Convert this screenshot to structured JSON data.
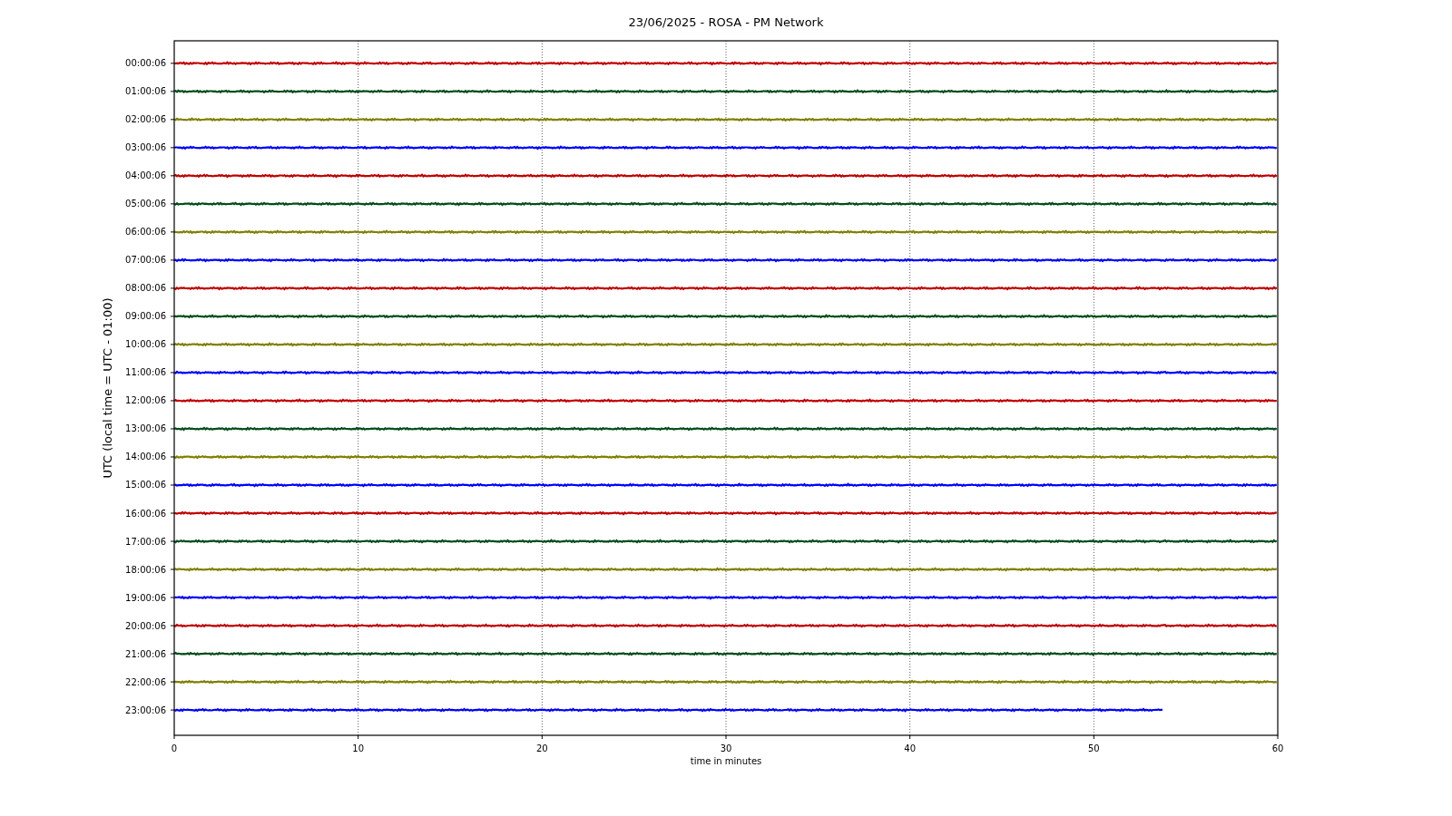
{
  "chart_data": {
    "type": "line",
    "title": "23/06/2025 - ROSA - PM Network",
    "xlabel": "time in minutes",
    "ylabel": "UTC (local time = UTC - 01:00)",
    "x": [
      0,
      53.8,
      60
    ],
    "xlim": [
      0,
      60
    ],
    "grid": "x",
    "ylim": [
      86046,
      -2874
    ],
    "xticks": [
      0,
      10,
      20,
      30,
      40,
      50,
      60
    ],
    "yticks": [
      {
        "value": 6,
        "label": "00:00:06"
      },
      {
        "value": 3606,
        "label": "01:00:06"
      },
      {
        "value": 7206,
        "label": "02:00:06"
      },
      {
        "value": 10806,
        "label": "03:00:06"
      },
      {
        "value": 14406,
        "label": "04:00:06"
      },
      {
        "value": 18006,
        "label": "05:00:06"
      },
      {
        "value": 21606,
        "label": "06:00:06"
      },
      {
        "value": 25206,
        "label": "07:00:06"
      },
      {
        "value": 28806,
        "label": "08:00:06"
      },
      {
        "value": 32406,
        "label": "09:00:06"
      },
      {
        "value": 36006,
        "label": "10:00:06"
      },
      {
        "value": 39606,
        "label": "11:00:06"
      },
      {
        "value": 43206,
        "label": "12:00:06"
      },
      {
        "value": 46806,
        "label": "13:00:06"
      },
      {
        "value": 50406,
        "label": "14:00:06"
      },
      {
        "value": 54006,
        "label": "15:00:06"
      },
      {
        "value": 57606,
        "label": "16:00:06"
      },
      {
        "value": 61206,
        "label": "17:00:06"
      },
      {
        "value": 64806,
        "label": "18:00:06"
      },
      {
        "value": 68406,
        "label": "19:00:06"
      },
      {
        "value": 72006,
        "label": "20:00:06"
      },
      {
        "value": 75606,
        "label": "21:00:06"
      },
      {
        "value": 79206,
        "label": "22:00:06"
      },
      {
        "value": 82806,
        "label": "23:00:06"
      }
    ],
    "series": [
      {
        "color": "#c00000",
        "values": [
          6,
          6,
          6
        ]
      },
      {
        "color": "#004d1a",
        "values": [
          3606,
          3606,
          3606
        ]
      },
      {
        "color": "#808000",
        "values": [
          7206,
          7206,
          7206
        ]
      },
      {
        "color": "#0000ff",
        "values": [
          10806,
          10806,
          10806
        ]
      },
      {
        "color": "#c00000",
        "values": [
          14406,
          14406,
          14406
        ]
      },
      {
        "color": "#004d1a",
        "values": [
          18006,
          18006,
          18006
        ]
      },
      {
        "color": "#808000",
        "values": [
          21606,
          21606,
          21606
        ]
      },
      {
        "color": "#0000ff",
        "values": [
          25206,
          25206,
          25206
        ]
      },
      {
        "color": "#c00000",
        "values": [
          28806,
          28806,
          28806
        ]
      },
      {
        "color": "#004d1a",
        "values": [
          32406,
          32406,
          32406
        ]
      },
      {
        "color": "#808000",
        "values": [
          36006,
          36006,
          36006
        ]
      },
      {
        "color": "#0000ff",
        "values": [
          39606,
          39606,
          39606
        ]
      },
      {
        "color": "#c00000",
        "values": [
          43206,
          43206,
          43206
        ]
      },
      {
        "color": "#004d1a",
        "values": [
          46806,
          46806,
          46806
        ]
      },
      {
        "color": "#808000",
        "values": [
          50406,
          50406,
          50406
        ]
      },
      {
        "color": "#0000ff",
        "values": [
          54006,
          54006,
          54006
        ]
      },
      {
        "color": "#c00000",
        "values": [
          57606,
          57606,
          57606
        ]
      },
      {
        "color": "#004d1a",
        "values": [
          61206,
          61206,
          61206
        ]
      },
      {
        "color": "#808000",
        "values": [
          64806,
          64806,
          64806
        ]
      },
      {
        "color": "#0000ff",
        "values": [
          68406,
          68406,
          68406
        ]
      },
      {
        "color": "#c00000",
        "values": [
          72006,
          72006,
          72006
        ]
      },
      {
        "color": "#004d1a",
        "values": [
          75606,
          75606,
          75606
        ]
      },
      {
        "color": "#808000",
        "values": [
          79206,
          79206,
          79206
        ]
      },
      {
        "color": "#0000ff",
        "values": [
          82806,
          82806,
          null
        ]
      }
    ]
  }
}
